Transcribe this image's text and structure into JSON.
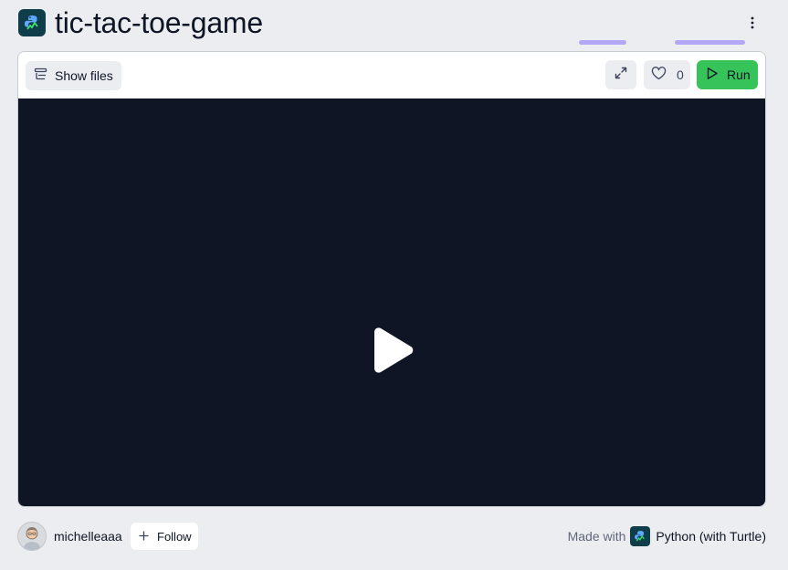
{
  "repl": {
    "title": "tic-tac-toe-game",
    "icon": "python-turtle-icon",
    "menu_icon": "kebab-menu-icon"
  },
  "toolbar": {
    "show_files_label": "Show files",
    "show_files_icon": "files-stack-icon",
    "expand_icon": "expand-icon",
    "like_icon": "heart-icon",
    "like_count": "0",
    "run_label": "Run",
    "run_icon": "play-outline-icon"
  },
  "viewport": {
    "play_icon": "play-icon",
    "background": "#0f1524"
  },
  "footer": {
    "username": "michelleaaa",
    "follow_label": "Follow",
    "made_with_label": "Made with",
    "language": "Python (with Turtle)"
  },
  "colors": {
    "run_green": "#36c45a",
    "highlight": "#b4a7f5",
    "page_bg": "#ebedf0"
  }
}
